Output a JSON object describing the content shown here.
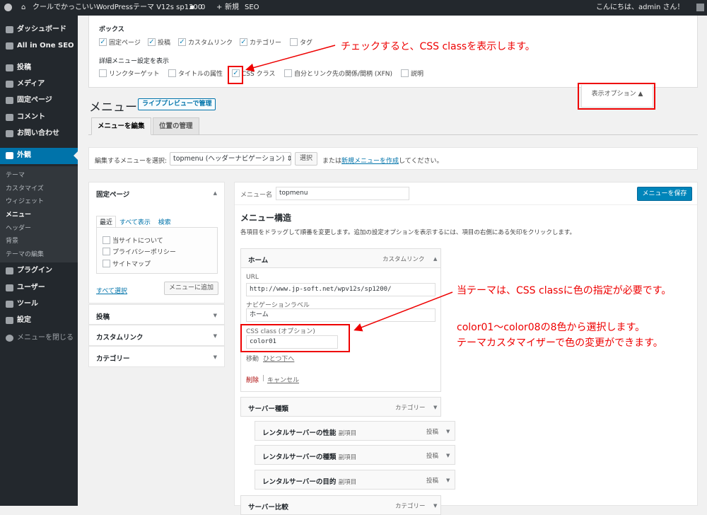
{
  "admin_bar": {
    "site_name": "クールでかっこいいWordPressテーマ V12s sp1200",
    "comments_count": "0",
    "new_label": "新規",
    "seo_label": "SEO",
    "greeting": "こんにちは、admin さん！"
  },
  "sidebar": {
    "items": [
      {
        "label": "ダッシュボード",
        "icon": "dashboard-icon"
      },
      {
        "label": "All in One SEO",
        "icon": "seo-icon"
      },
      {
        "label": "投稿",
        "icon": "pin-icon"
      },
      {
        "label": "メディア",
        "icon": "media-icon"
      },
      {
        "label": "固定ページ",
        "icon": "page-icon"
      },
      {
        "label": "コメント",
        "icon": "comment-icon"
      },
      {
        "label": "お問い合わせ",
        "icon": "mail-icon"
      },
      {
        "label": "外観",
        "icon": "brush-icon"
      },
      {
        "label": "プラグイン",
        "icon": "plugin-icon"
      },
      {
        "label": "ユーザー",
        "icon": "user-icon"
      },
      {
        "label": "ツール",
        "icon": "wrench-icon"
      },
      {
        "label": "設定",
        "icon": "settings-icon"
      },
      {
        "label": "メニューを閉じる",
        "icon": "collapse-icon"
      }
    ],
    "submenu": [
      "テーマ",
      "カスタマイズ",
      "ウィジェット",
      "メニュー",
      "ヘッダー",
      "背景",
      "テーマの編集"
    ]
  },
  "screen_options": {
    "boxes_heading": "ボックス",
    "boxes": [
      "固定ページ",
      "投稿",
      "カスタムリンク",
      "カテゴリー",
      "タグ"
    ],
    "boxes_checked": [
      true,
      true,
      true,
      true,
      false
    ],
    "advanced_heading": "詳細メニュー設定を表示",
    "advanced": [
      "リンクターゲット",
      "タイトルの属性",
      "CSS クラス",
      "自分とリンク先の関係/間柄 (XFN)",
      "説明"
    ],
    "advanced_checked": [
      false,
      false,
      true,
      false,
      false
    ],
    "tab_label": "表示オプション ▲"
  },
  "annotations": {
    "css_class_note": "チェックすると、CSS classを表示します。",
    "color_note1": "当テーマは、CSS classに色の指定が必要です。",
    "color_note2": "color01〜color08の8色から選択します。",
    "color_note3": "テーマカスタマイザーで色の変更ができます。"
  },
  "header": {
    "title": "メニュー",
    "live_preview": "ライブプレビューで管理",
    "tabs": [
      "メニューを編集",
      "位置の管理"
    ]
  },
  "select_bar": {
    "label": "編集するメニューを選択:",
    "selected": "topmenu (ヘッダーナビゲーション) ⇕",
    "select_button": "選択",
    "or_text": "または",
    "create_link": "新規メニューを作成",
    "suffix": "してください。"
  },
  "left": {
    "pages_title": "固定ページ",
    "tabs": [
      "最近",
      "すべて表示",
      "検索"
    ],
    "pages": [
      "当サイトについて",
      "プライバシーポリシー",
      "サイトマップ"
    ],
    "select_all": "すべて選択",
    "add_button": "メニューに追加",
    "boxes": [
      "投稿",
      "カスタムリンク",
      "カテゴリー"
    ]
  },
  "menu": {
    "name_label": "メニュー名",
    "name_value": "topmenu",
    "save_button": "メニューを保存",
    "structure_title": "メニュー構造",
    "instructions": "各項目をドラッグして順番を変更します。追加の設定オプションを表示するには、項目の右側にある矢印をクリックします。",
    "expanded": {
      "title": "ホーム",
      "type": "カスタムリンク",
      "url_label": "URL",
      "url_value": "http://www.jp-soft.net/wpv12s/sp1200/",
      "nav_label": "ナビゲーションラベル",
      "nav_value": "ホーム",
      "css_label": "CSS class (オプション)",
      "css_value": "color01",
      "move_label": "移動",
      "move_link": "ひとつ下へ",
      "delete": "削除",
      "separator": "|",
      "cancel": "キャンセル"
    },
    "items": [
      {
        "title": "サーバー種類",
        "sub": "",
        "type": "カテゴリー"
      },
      {
        "title": "レンタルサーバーの性能",
        "sub": "副項目",
        "type": "投稿"
      },
      {
        "title": "レンタルサーバーの種類",
        "sub": "副項目",
        "type": "投稿"
      },
      {
        "title": "レンタルサーバーの目的",
        "sub": "副項目",
        "type": "投稿"
      },
      {
        "title": "サーバー比較",
        "sub": "",
        "type": "カテゴリー"
      }
    ]
  }
}
